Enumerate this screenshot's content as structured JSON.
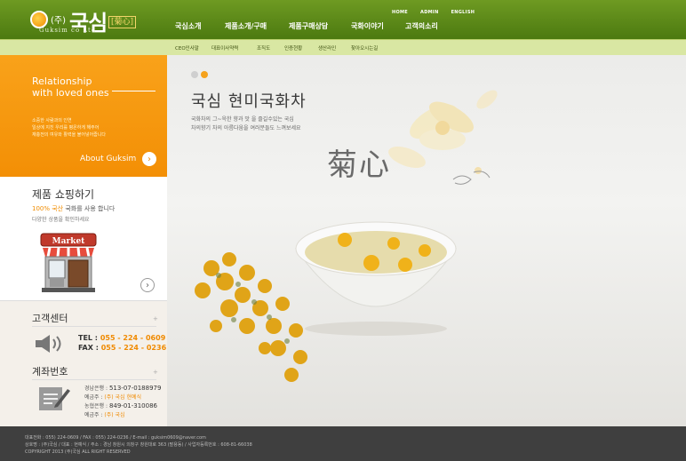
{
  "header": {
    "logo": {
      "corp": "(주)",
      "name": "국심",
      "tag": "[菊心]",
      "eng": "Guksim co Ltd"
    },
    "util_links": [
      "HOME",
      "ADMIN",
      "ENGLISH"
    ],
    "nav": [
      "국심소개",
      "제품소개/구매",
      "제품구매상담",
      "국화이야기",
      "고객의소리"
    ]
  },
  "subnav": [
    "CEO인사말",
    "대표이사약력",
    "조직도",
    "인증현황",
    "생산라인",
    "찾아오시는길"
  ],
  "left": {
    "relationship": {
      "title_line1": "Relationship",
      "title_line2": "with loved ones",
      "desc_line1": "소중한 사람과의 인연",
      "desc_line2": "일상에 지친 우리를 평온하게 해주어",
      "desc_line3": "재충전의 여유와 활력을 불어넣어줍니다",
      "about_label": "About Guksim",
      "about_icon": "chevron-right-icon"
    },
    "shop": {
      "title": "제품 쇼핑하기",
      "sub_highlight": "100% 국산",
      "sub_rest": " 국화를 사용 합니다",
      "sub2": "다양한 상품을 확인하세요",
      "market_sign": "Market"
    },
    "customer_center": {
      "title": "고객센터",
      "tel_label": "TEL :",
      "tel": "055 - 224 - 0609",
      "fax_label": "FAX :",
      "fax": "055 - 224 - 0236"
    },
    "account": {
      "title": "계좌번호",
      "bank1_name": "경남은행 :",
      "bank1_acc": "513-07-0188979",
      "bank1_holder_label": "예금주 :",
      "bank1_holder": "(주) 국심 현예식",
      "bank2_name": "농협은행 :",
      "bank2_acc": "849-01-310086",
      "bank2_holder_label": "예금주 :",
      "bank2_holder": "(주) 국심"
    }
  },
  "main": {
    "headline": "국심 현미국화차",
    "copy_line1": "국화차의 그~윽한 향과 맛 을 즐길수있는 국심",
    "copy_line2": "차의향기 차의 아름다움을 여러분들도 느껴보세요",
    "hanja": "菊心",
    "dot_colors": [
      "#cfcfcf",
      "#f5a21c"
    ]
  },
  "footer": {
    "line1": "대표전화 : 055) 224-0609 / FAX : 055) 224-0236 / E-mail : guksim0609@naver.com",
    "line2": "상호명 : (주)국심 / 대표 : 현예식 / 주소 : 경남 창원시 의창구 창원대로 363 (팔용동) / 사업자등록번호 : 608-81-66038",
    "line3": "COPYRIGHT 2013 (주)국심 ALL RIGHT RESERVED"
  },
  "colors": {
    "header_green": "#5a8618",
    "accent_orange": "#f5961a",
    "subnav_bg": "#d9e7a3",
    "footer_bg": "#3f3f3f"
  }
}
